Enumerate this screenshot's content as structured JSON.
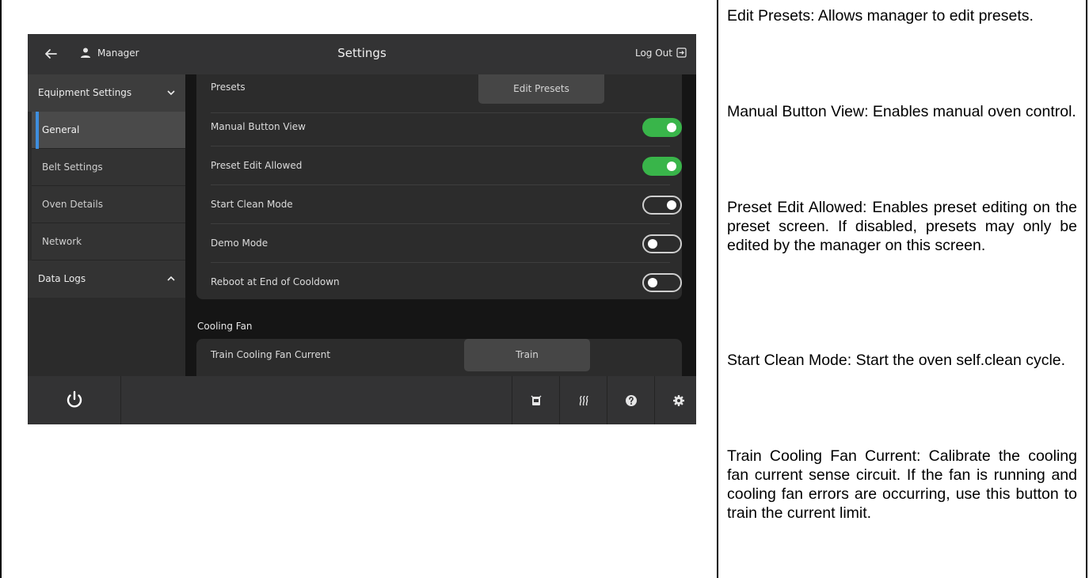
{
  "device": {
    "header": {
      "user": "Manager",
      "title": "Settings",
      "logout": "Log Out"
    },
    "sidebar": {
      "group_equipment": "Equipment Settings",
      "items": [
        "General",
        "Belt Settings",
        "Oven Details",
        "Network"
      ],
      "active_item": "General",
      "group_logs": "Data Logs"
    },
    "settings": {
      "presets_label": "Presets",
      "presets_button": "Edit Presets",
      "toggles": [
        {
          "label": "Manual Button View",
          "state": "on"
        },
        {
          "label": "Preset Edit Allowed",
          "state": "on"
        },
        {
          "label": "Start Clean Mode",
          "state": "off"
        },
        {
          "label": "Demo Mode",
          "state": "off"
        },
        {
          "label": "Reboot at End of Cooldown",
          "state": "off"
        }
      ],
      "cooling_section": "Cooling Fan",
      "train_label": "Train Cooling Fan Current",
      "train_button": "Train"
    },
    "bottom_icons": [
      "power-icon",
      "oven-icon",
      "heat-icon",
      "help-icon",
      "gear-icon"
    ],
    "colors": {
      "toggle_on": "#39b54a",
      "active_indicator": "#3e8ede"
    }
  },
  "descriptions": [
    "Edit Presets: Allows manager to edit presets.",
    "Manual Button View: Enables manual oven control.",
    "Preset Edit Allowed: Enables preset editing on the preset screen. If disabled, presets may only be edited by the manager on this screen.",
    "Start Clean Mode: Start the oven self.clean cycle.",
    "Train Cooling Fan Current: Calibrate the cooling fan current sense circuit. If the fan is running and cooling fan errors are occurring, use this button to train the current limit."
  ]
}
